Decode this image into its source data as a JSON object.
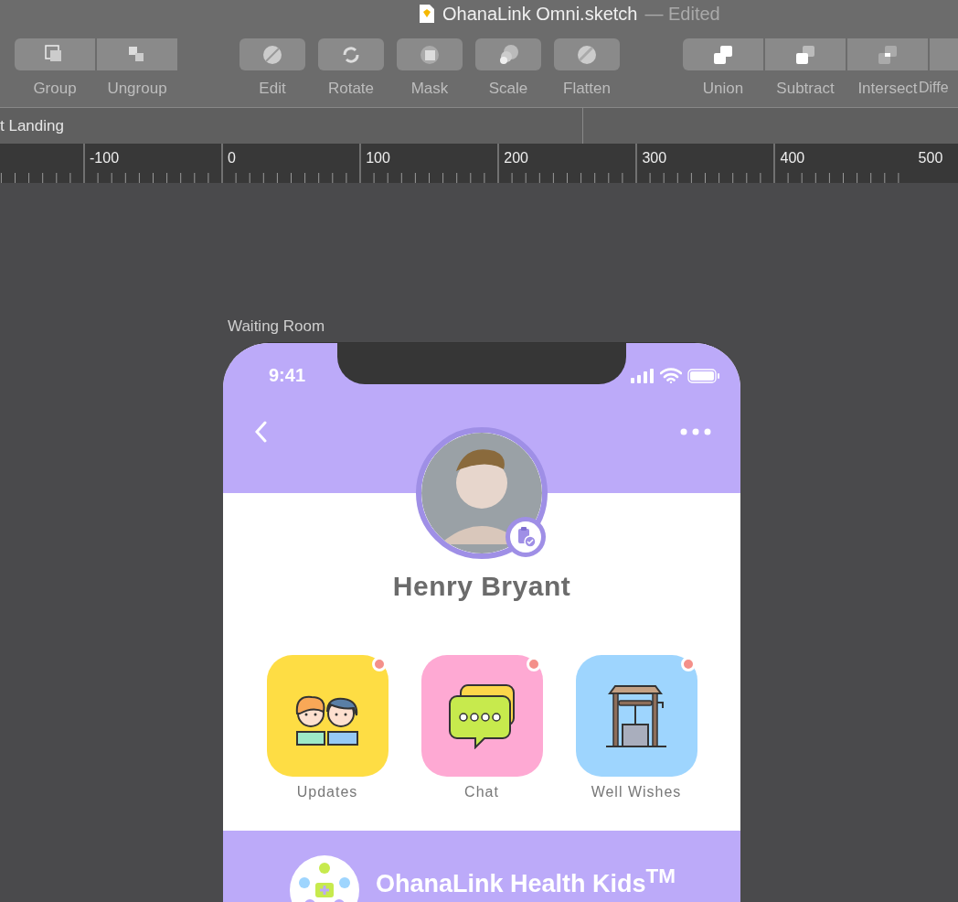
{
  "window": {
    "title": "OhanaLink Omni.sketch",
    "status": "— Edited"
  },
  "toolbar": {
    "groups": [
      {
        "kind": "segmented",
        "items": [
          {
            "label": "Group",
            "kind": "group"
          },
          {
            "label": "Ungroup",
            "kind": "ungroup"
          }
        ]
      },
      {
        "kind": "separate",
        "items": [
          {
            "label": "Edit",
            "kind": "edit"
          },
          {
            "label": "Rotate",
            "kind": "rotate"
          },
          {
            "label": "Mask",
            "kind": "mask"
          },
          {
            "label": "Scale",
            "kind": "scale"
          },
          {
            "label": "Flatten",
            "kind": "flatten"
          }
        ]
      },
      {
        "kind": "segmented",
        "items": [
          {
            "label": "Union",
            "kind": "union"
          },
          {
            "label": "Subtract",
            "kind": "subtract"
          },
          {
            "label": "Intersect",
            "kind": "intersect"
          },
          {
            "label": "Diffe",
            "kind": "difference"
          }
        ]
      }
    ]
  },
  "page_tab": {
    "label": "t Landing"
  },
  "ruler": {
    "labels": [
      "-100",
      "0",
      "100",
      "200",
      "300",
      "400",
      "500"
    ]
  },
  "artboard": {
    "name": "Waiting Room",
    "status_bar": {
      "time": "9:41"
    },
    "profile": {
      "name": "Henry Bryant"
    },
    "tiles": [
      {
        "label": "Updates",
        "kind": "updates",
        "color": "#fedd44",
        "unread": true
      },
      {
        "label": "Chat",
        "kind": "chat",
        "color": "#fea9d3",
        "unread": true
      },
      {
        "label": "Well Wishes",
        "kind": "well",
        "color": "#9ed5fe",
        "unread": true
      }
    ],
    "footer": {
      "brand": "OhanaLink Health Kids$^{TM}$"
    }
  }
}
